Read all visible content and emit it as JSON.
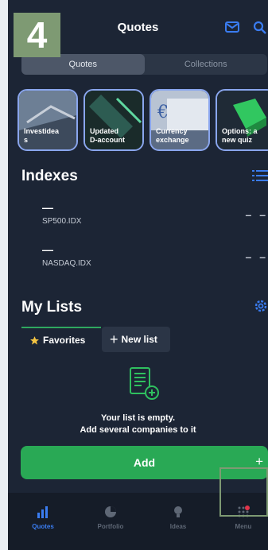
{
  "step_badge": "4",
  "header": {
    "title": "Quotes",
    "icons": [
      "mail-icon",
      "search-icon"
    ]
  },
  "segment": {
    "tabs": [
      "Quotes",
      "Collections"
    ],
    "active": "Quotes"
  },
  "stories": [
    {
      "label": "Investidea\ns"
    },
    {
      "label": "Updated\nD-account"
    },
    {
      "label": "Currency\nexchange"
    },
    {
      "label": "Options: a\nnew quiz"
    }
  ],
  "indexes": {
    "title": "Indexes",
    "items": [
      {
        "dash": "—",
        "name": "SP500.IDX",
        "value": "– –"
      },
      {
        "dash": "—",
        "name": "NASDAQ.IDX",
        "value": "– –"
      }
    ]
  },
  "my_lists": {
    "title": "My Lists",
    "tabs": {
      "favorites": "Favorites",
      "new_list": "New list"
    },
    "empty_line1": "Your list is empty.",
    "empty_line2": "Add several companies to it",
    "add_button": "Add",
    "add_plus": "+"
  },
  "tabbar": {
    "items": [
      {
        "label": "Quotes"
      },
      {
        "label": "Portfolio"
      },
      {
        "label": "Ideas"
      },
      {
        "label": "Menu"
      }
    ],
    "active": "Quotes"
  },
  "colors": {
    "background": "#1c2535",
    "accent_blue": "#3a7cf0",
    "accent_green": "#29a955",
    "badge": "#7e9a73"
  }
}
